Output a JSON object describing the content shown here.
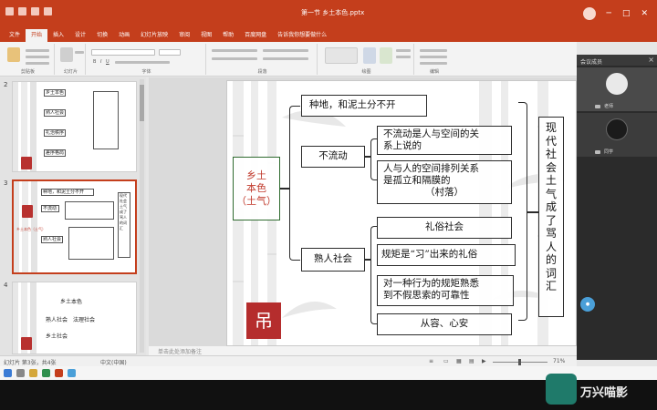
{
  "window": {
    "title": "第一节 乡土本色.pptx"
  },
  "tabs": [
    "文件",
    "开始",
    "插入",
    "设计",
    "切换",
    "动画",
    "幻灯片放映",
    "审阅",
    "视图",
    "帮助",
    "百度网盘",
    "告诉我你想要做什么"
  ],
  "ribbon_groups": [
    "剪贴板",
    "幻灯片",
    "字体",
    "段落",
    "绘图",
    "编辑"
  ],
  "thumbs": [
    {
      "num": "2",
      "boxes": [
        "乡土本色",
        "熟人社会",
        "礼治秩序",
        "差序格局"
      ]
    },
    {
      "num": "3",
      "boxes": [
        "种地，和泥土分不开",
        "不流动",
        "熟人社会",
        "乡土本色（土气）",
        "现代社会土气成了骂人的词汇"
      ]
    },
    {
      "num": "4",
      "lines": [
        "乡土本色",
        "熟人社会　法理社会",
        "乡土社会"
      ]
    }
  ],
  "slide": {
    "root": "乡土本色（土气）",
    "root_lines": [
      "乡土",
      "本色",
      "（土气）"
    ],
    "branch1": "种地，和泥土分不开",
    "branch2": "不流动",
    "branch2_children": [
      "不流动是人与空间的关系上说的",
      "人与人的空间排列关系是孤立和隔膜的（村落）"
    ],
    "branch2_child1_lines": [
      "不流动是人与空间的关",
      "系上说的"
    ],
    "branch2_child2_lines": [
      "人与人的空间排列关系",
      "是孤立和隔膜的",
      "（村落）"
    ],
    "branch3": "熟人社会",
    "branch3_children": [
      "礼俗社会",
      "规矩是“习”出来的礼俗",
      "对一种行为的规矩熟悉到不假思索的可靠性",
      "从容、心安"
    ],
    "branch3_child3_lines": [
      "对一种行为的规矩熟悉",
      "到不假思索的可靠性"
    ],
    "conclusion": "现代社会土气成了骂人的词汇",
    "conclusion_chars": [
      "现",
      "代",
      "社",
      "会",
      "土",
      "气",
      "成",
      "了",
      "骂",
      "人",
      "的",
      "词",
      "汇"
    ],
    "seal": "吊"
  },
  "notes_placeholder": "单击此处添加备注",
  "status": {
    "slide_info": "幻灯片 第3张，共4张",
    "lang": "中文(中国)",
    "zoom": "71%"
  },
  "video": {
    "header": "会议成员",
    "participants": [
      {
        "name": "老师"
      },
      {
        "name": "同学"
      }
    ]
  },
  "watermark": "万兴喵影",
  "colors": {
    "accent": "#c43e1c",
    "root_text": "#c0392b",
    "seal": "#b52d2d"
  }
}
